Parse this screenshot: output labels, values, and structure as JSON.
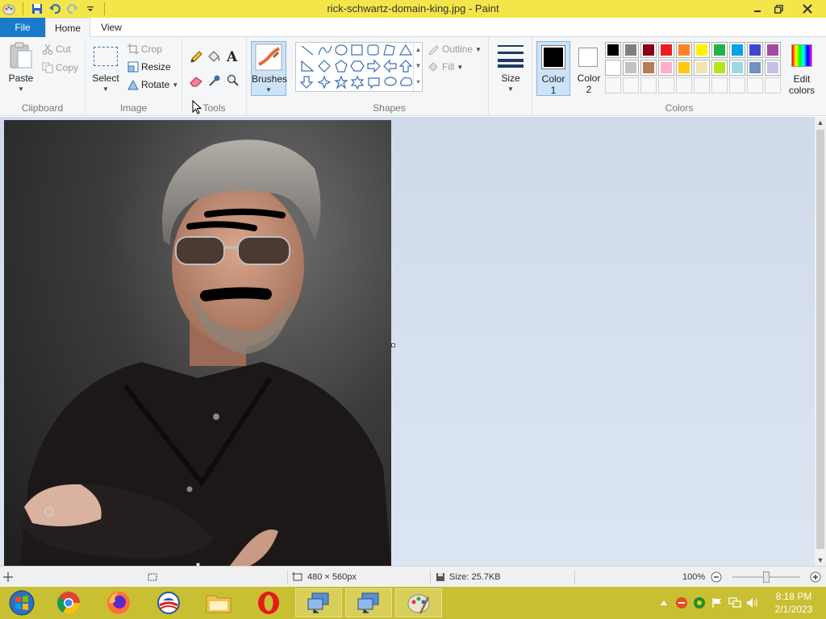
{
  "window": {
    "title": "rick-schwartz-domain-king.jpg - Paint"
  },
  "tabs": {
    "file": "File",
    "home": "Home",
    "view": "View"
  },
  "clipboard": {
    "paste": "Paste",
    "cut": "Cut",
    "copy": "Copy",
    "label": "Clipboard"
  },
  "image_group": {
    "select": "Select",
    "crop": "Crop",
    "resize": "Resize",
    "rotate": "Rotate",
    "label": "Image"
  },
  "tools": {
    "label": "Tools"
  },
  "brushes": {
    "label": "Brushes"
  },
  "shapes": {
    "outline": "Outline",
    "fill": "Fill",
    "label": "Shapes"
  },
  "size": {
    "label": "Size"
  },
  "colors": {
    "color1": "Color",
    "color1_num": "1",
    "color2": "Color",
    "color2_num": "2",
    "edit_colors_1": "Edit",
    "edit_colors_2": "colors",
    "label": "Colors",
    "color1_value": "#000000",
    "color2_value": "#ffffff",
    "palette_row1": [
      "#000000",
      "#7f7f7f",
      "#880015",
      "#ed1c24",
      "#ff7f27",
      "#fff200",
      "#22b14c",
      "#00a2e8",
      "#3f48cc",
      "#a349a4"
    ],
    "palette_row2": [
      "#ffffff",
      "#c3c3c3",
      "#b97a57",
      "#ffaec9",
      "#ffc90e",
      "#efe4b0",
      "#b5e61d",
      "#99d9ea",
      "#7092be",
      "#c8bfe7"
    ]
  },
  "status": {
    "dimensions": "480 × 560px",
    "size": "Size: 25.7KB",
    "zoom": "100%"
  },
  "taskbar": {
    "time": "8:18 PM",
    "date": "2/1/2023"
  }
}
